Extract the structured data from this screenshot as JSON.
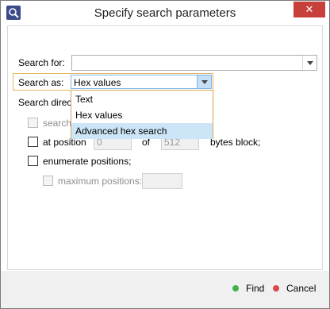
{
  "window": {
    "title": "Specify search parameters",
    "close_glyph": "✕"
  },
  "icons": {
    "app": "magnifier-app-icon",
    "close": "close-icon",
    "dropdown": "chevron-down-icon"
  },
  "colors": {
    "close_bg": "#c7403a",
    "selected_item": "#cde6f7",
    "find_dot": "#3fb04c",
    "cancel_dot": "#d94848"
  },
  "form": {
    "search_for": {
      "label": "Search for:",
      "value": ""
    },
    "search_as": {
      "label": "Search as:",
      "value": "Hex values",
      "options": [
        "Text",
        "Hex values",
        "Advanced hex search"
      ],
      "highlighted": "Advanced hex search"
    },
    "search_direction_label": "Search direct",
    "search_opt_label": "search",
    "at_position": {
      "label": "at position",
      "value": "0",
      "of_label": "of",
      "block_value": "512",
      "suffix": "bytes block;"
    },
    "enumerate": {
      "label": "enumerate positions;"
    },
    "maximum": {
      "label": "maximum positions:",
      "value": ""
    }
  },
  "footer": {
    "find_label": "Find",
    "cancel_label": "Cancel"
  }
}
